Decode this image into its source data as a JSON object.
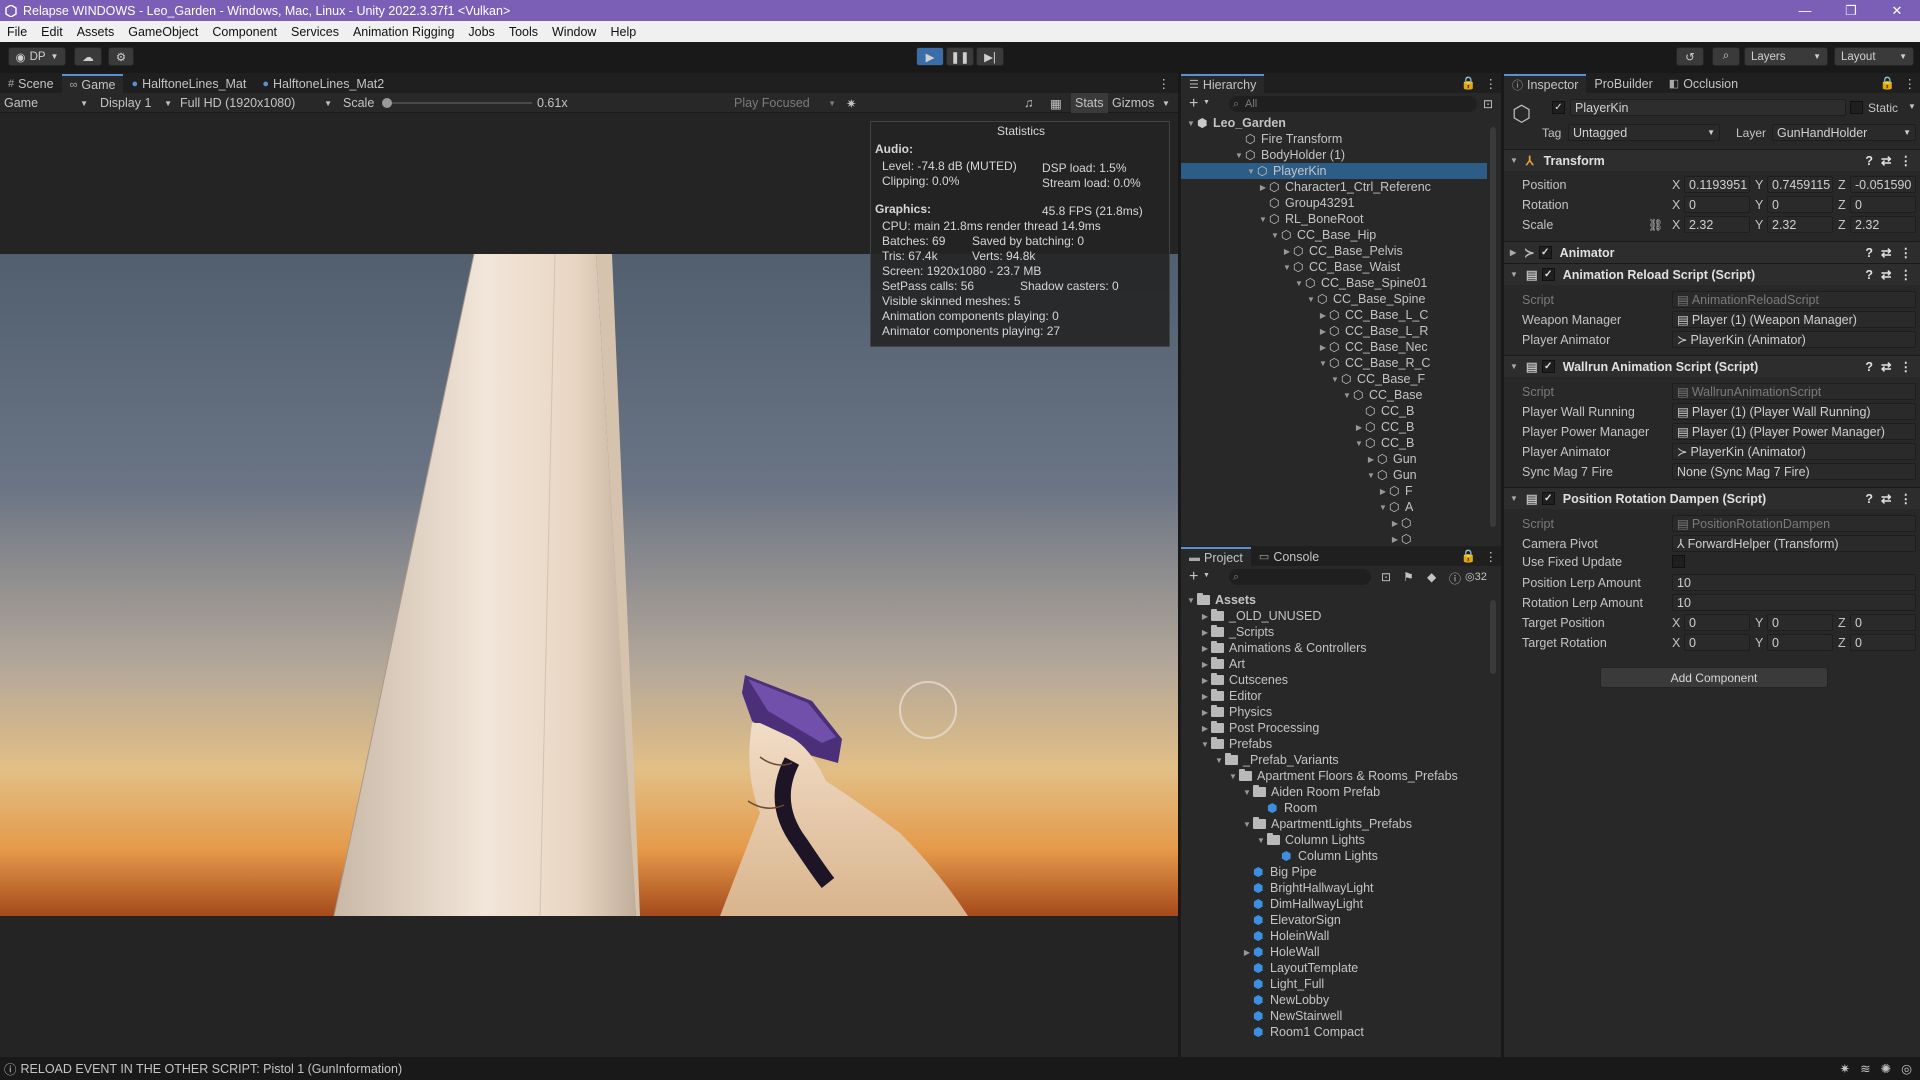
{
  "window": {
    "title": "Relapse WINDOWS - Leo_Garden - Windows, Mac, Linux - Unity 2022.3.37f1 <Vulkan>",
    "min": "—",
    "max": "❐",
    "close": "✕"
  },
  "menu": [
    "File",
    "Edit",
    "Assets",
    "GameObject",
    "Component",
    "Services",
    "Animation Rigging",
    "Jobs",
    "Tools",
    "Window",
    "Help"
  ],
  "toolbar": {
    "account": "DP",
    "layers": "Layers",
    "layout": "Layout"
  },
  "tabs": {
    "scene": "Scene",
    "game": "Game",
    "mat1": "HalftoneLines_Mat",
    "mat2": "HalftoneLines_Mat2"
  },
  "gamebar": {
    "mode": "Game",
    "display": "Display 1",
    "resolution": "Full HD (1920x1080)",
    "scale_label": "Scale",
    "scale_value": "0.61x",
    "play_focused": "Play Focused",
    "stats": "Stats",
    "gizmos": "Gizmos"
  },
  "stats": {
    "title": "Statistics",
    "audio": "Audio:",
    "level": "Level: -74.8 dB (MUTED)",
    "dsp": "DSP load: 1.5%",
    "clipping": "Clipping: 0.0%",
    "stream": "Stream load: 0.0%",
    "graphics": "Graphics:",
    "fps": "45.8 FPS (21.8ms)",
    "cpu": "CPU: main 21.8ms  render thread 14.9ms",
    "batches": "Batches: 69",
    "saved": "Saved by batching: 0",
    "tris": "Tris: 67.4k",
    "verts": "Verts: 94.8k",
    "screen": "Screen: 1920x1080 - 23.7 MB",
    "setpass": "SetPass calls: 56",
    "shadow": "Shadow casters: 0",
    "skinned": "Visible skinned meshes: 5",
    "anim": "Animation components playing: 0",
    "animator": "Animator components playing: 27"
  },
  "hierarchy": {
    "tab": "Hierarchy",
    "search": "All",
    "rows": [
      {
        "label": "Leo_Garden",
        "open": true,
        "icon": "unity"
      },
      {
        "label": "Fire Transform",
        "open": null
      },
      {
        "label": "BodyHolder (1)",
        "open": true
      },
      {
        "label": "PlayerKin",
        "open": true,
        "selected": true
      },
      {
        "label": "Character1_Ctrl_Referenc",
        "open": false
      },
      {
        "label": "Group43291",
        "open": null
      },
      {
        "label": "RL_BoneRoot",
        "open": true
      },
      {
        "label": "CC_Base_Hip",
        "open": true
      },
      {
        "label": "CC_Base_Pelvis",
        "open": false
      },
      {
        "label": "CC_Base_Waist",
        "open": true
      },
      {
        "label": "CC_Base_Spine01",
        "open": true
      },
      {
        "label": "CC_Base_Spine",
        "open": true
      },
      {
        "label": "CC_Base_L_C",
        "open": false
      },
      {
        "label": "CC_Base_L_R",
        "open": false
      },
      {
        "label": "CC_Base_Nec",
        "open": false
      },
      {
        "label": "CC_Base_R_C",
        "open": true
      },
      {
        "label": "CC_Base_F",
        "open": true
      },
      {
        "label": "CC_Base",
        "open": true
      },
      {
        "label": "CC_B",
        "open": null
      },
      {
        "label": "CC_B",
        "open": false
      },
      {
        "label": "CC_B",
        "open": true
      },
      {
        "label": "Gun",
        "open": false
      },
      {
        "label": "Gun",
        "open": true
      },
      {
        "label": "F",
        "open": false
      },
      {
        "label": "A",
        "open": true
      },
      {
        "label": "",
        "open": false
      },
      {
        "label": "",
        "open": false
      }
    ]
  },
  "project": {
    "tab": "Project",
    "console": "Console",
    "count": "32",
    "rows": [
      {
        "label": "Assets",
        "open": true,
        "type": "folder",
        "bold": true
      },
      {
        "label": "_OLD_UNUSED",
        "open": false,
        "type": "folder"
      },
      {
        "label": "_Scripts",
        "open": false,
        "type": "folder"
      },
      {
        "label": "Animations & Controllers",
        "open": false,
        "type": "folder"
      },
      {
        "label": "Art",
        "open": false,
        "type": "folder"
      },
      {
        "label": "Cutscenes",
        "open": false,
        "type": "folder"
      },
      {
        "label": "Editor",
        "open": false,
        "type": "folder"
      },
      {
        "label": "Physics",
        "open": false,
        "type": "folder"
      },
      {
        "label": "Post Processing",
        "open": false,
        "type": "folder"
      },
      {
        "label": "Prefabs",
        "open": true,
        "type": "folder"
      },
      {
        "label": "_Prefab_Variants",
        "open": true,
        "type": "folder"
      },
      {
        "label": "Apartment Floors & Rooms_Prefabs",
        "open": true,
        "type": "folder"
      },
      {
        "label": "Aiden Room Prefab",
        "open": true,
        "type": "folder"
      },
      {
        "label": "Room",
        "open": null,
        "type": "prefab"
      },
      {
        "label": "ApartmentLights_Prefabs",
        "open": true,
        "type": "folder"
      },
      {
        "label": "Column Lights",
        "open": true,
        "type": "folder"
      },
      {
        "label": "Column Lights",
        "open": null,
        "type": "prefab"
      },
      {
        "label": "Big Pipe",
        "open": null,
        "type": "prefab"
      },
      {
        "label": "BrightHallwayLight",
        "open": null,
        "type": "prefab"
      },
      {
        "label": "DimHallwayLight",
        "open": null,
        "type": "prefab"
      },
      {
        "label": "ElevatorSign",
        "open": null,
        "type": "prefab"
      },
      {
        "label": "HoleinWall",
        "open": null,
        "type": "prefab"
      },
      {
        "label": "HoleWall",
        "open": false,
        "type": "prefab"
      },
      {
        "label": "LayoutTemplate",
        "open": null,
        "type": "prefab"
      },
      {
        "label": "Light_Full",
        "open": null,
        "type": "prefab"
      },
      {
        "label": "NewLobby",
        "open": null,
        "type": "prefab"
      },
      {
        "label": "NewStairwell",
        "open": null,
        "type": "prefab"
      },
      {
        "label": "Room1 Compact",
        "open": null,
        "type": "prefab"
      }
    ]
  },
  "inspector": {
    "tab": "Inspector",
    "probuilder": "ProBuilder",
    "occlusion": "Occlusion",
    "name": "PlayerKin",
    "static": "Static",
    "tag_label": "Tag",
    "tag": "Untagged",
    "layer_label": "Layer",
    "layer": "GunHandHolder",
    "transform": {
      "title": "Transform",
      "position": "Position",
      "rotation": "Rotation",
      "scale": "Scale",
      "pos": [
        "0.1193951",
        "0.7459115",
        "-0.051590"
      ],
      "rot": [
        "0",
        "0",
        "0"
      ],
      "scl": [
        "2.32",
        "2.32",
        "2.32"
      ]
    },
    "animator": "Animator",
    "reload": {
      "title": "Animation Reload Script (Script)",
      "script": "Script",
      "script_val": "AnimationReloadScript",
      "weapon": "Weapon Manager",
      "weapon_val": "Player (1) (Weapon Manager)",
      "anim": "Player Animator",
      "anim_val": "PlayerKin (Animator)"
    },
    "wallrun": {
      "title": "Wallrun Animation Script (Script)",
      "script": "Script",
      "script_val": "WallrunAnimationScript",
      "wall": "Player Wall Running",
      "wall_val": "Player (1) (Player Wall Running)",
      "power": "Player Power Manager",
      "power_val": "Player (1) (Player Power Manager)",
      "anim": "Player Animator",
      "anim_val": "PlayerKin (Animator)",
      "sync": "Sync Mag 7 Fire",
      "sync_val": "None (Sync Mag 7 Fire)"
    },
    "dampen": {
      "title": "Position Rotation Dampen (Script)",
      "script": "Script",
      "script_val": "PositionRotationDampen",
      "pivot": "Camera Pivot",
      "pivot_val": "ForwardHelper (Transform)",
      "fixed": "Use Fixed Update",
      "plerp": "Position Lerp Amount",
      "plerp_val": "10",
      "rlerp": "Rotation Lerp Amount",
      "rlerp_val": "10",
      "tpos": "Target Position",
      "trot": "Target Rotation",
      "tpos_v": [
        "0",
        "0",
        "0"
      ],
      "trot_v": [
        "0",
        "0",
        "0"
      ]
    },
    "add": "Add Component"
  },
  "status": {
    "message": "RELOAD EVENT IN THE OTHER SCRIPT: Pistol 1 (GunInformation)"
  },
  "colors": {
    "title": "#7b5fb7",
    "selection": "#2c5d87",
    "accent": "#5a8fd1"
  }
}
